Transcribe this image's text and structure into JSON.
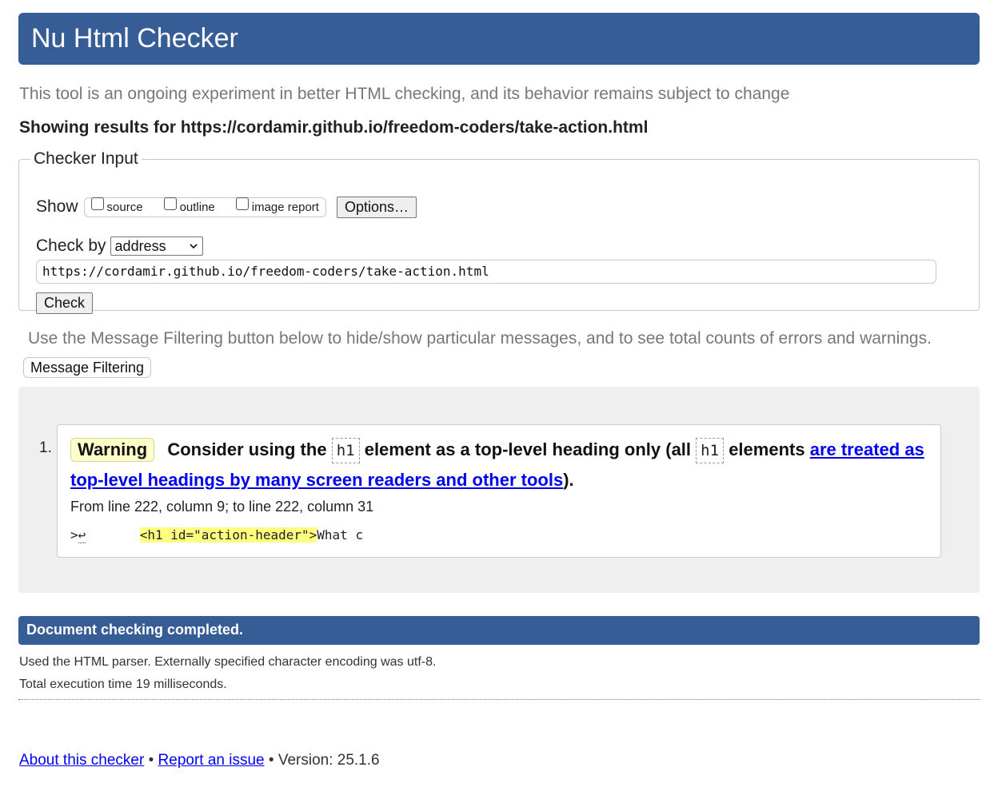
{
  "app_title": "Nu Html Checker",
  "intro": "This tool is an ongoing experiment in better HTML checking, and its behavior remains subject to change",
  "results_heading": "Showing results for https://cordamir.github.io/freedom-coders/take-action.html",
  "checker_input": {
    "legend": "Checker Input",
    "show_label": "Show",
    "options": [
      {
        "label": "source",
        "checked": false
      },
      {
        "label": "outline",
        "checked": false
      },
      {
        "label": "image report",
        "checked": false
      }
    ],
    "options_button": "Options…",
    "check_by_label": "Check by",
    "check_by_value": "address",
    "url_value": "https://cordamir.github.io/freedom-coders/take-action.html",
    "check_button": "Check"
  },
  "filter_note": "Use the Message Filtering button below to hide/show particular messages, and to see total counts of errors and warnings.",
  "filter_button": "Message Filtering",
  "messages": [
    {
      "number": "1.",
      "type": "Warning",
      "text_before": "Consider using the",
      "code1": "h1",
      "text_mid": "element as a top-level heading only (all",
      "code2": "h1",
      "text_after": "elements",
      "link_text_1": "are treated as",
      "link_text_2": "top-level headings by many screen readers and other tools",
      "text_end": ").",
      "location": "From line 222, column 9; to line 222, column 31",
      "extract_prefix": ">",
      "extract_lf": "↩",
      "extract_spacing": "       ",
      "extract_highlight": "<h1 id=\"action-header\">",
      "extract_suffix": "What c"
    }
  ],
  "completion": "Document checking completed.",
  "parser_info": "Used the HTML parser. Externally specified character encoding was utf-8.",
  "execution_time": "Total execution time 19 milliseconds.",
  "footer": {
    "about_link": "About this checker",
    "bullet": "•",
    "report_link": "Report an issue",
    "version": "Version: 25.1.6"
  },
  "colors": {
    "header_bg": "#365d95",
    "warning_badge_bg": "#ffffcc",
    "highlight": "#ffff80",
    "link": "#0000ee",
    "messages_bg": "#efefef"
  }
}
